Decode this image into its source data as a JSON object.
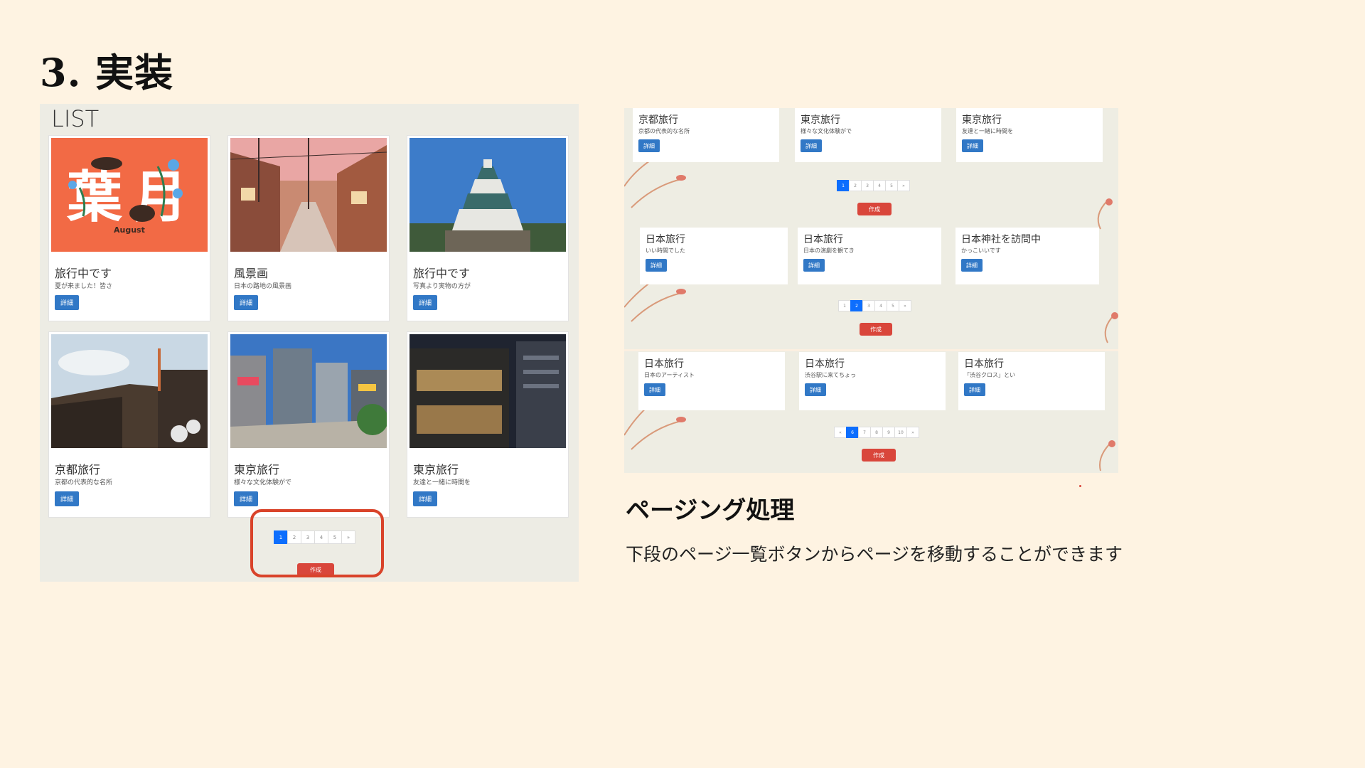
{
  "slide": {
    "title": "3. 実装",
    "section_heading": "ページング処理",
    "section_body": "下段のページ一覧ボタンからページを移動することができます"
  },
  "left_screenshot": {
    "heading": "LIST",
    "cards": [
      {
        "title": "旅行中です",
        "desc": "夏が来ました！皆さ",
        "button": "詳細",
        "image": "august-illustration"
      },
      {
        "title": "風景画",
        "desc": "日本の路地の風景画",
        "button": "詳細",
        "image": "street-illustration"
      },
      {
        "title": "旅行中です",
        "desc": "写真より実物の方が",
        "button": "詳細",
        "image": "castle-photo"
      },
      {
        "title": "京都旅行",
        "desc": "京都の代表的な名所",
        "button": "詳細",
        "image": "kyoto-photo"
      },
      {
        "title": "東京旅行",
        "desc": "様々な文化体験がで",
        "button": "詳細",
        "image": "shibuya-photo"
      },
      {
        "title": "東京旅行",
        "desc": "友達と一緒に時間を",
        "button": "詳細",
        "image": "night-building-photo"
      }
    ],
    "pager": [
      "1",
      "2",
      "3",
      "4",
      "5",
      "»"
    ],
    "pager_active": 0,
    "create_button": "作成",
    "august_text": "August",
    "august_kanji_left": "葉",
    "august_kanji_right": "月"
  },
  "right_screenshot": {
    "panels": [
      {
        "cards": [
          {
            "title": "京都旅行",
            "desc": "京都の代表的な名所",
            "button": "詳細"
          },
          {
            "title": "東京旅行",
            "desc": "様々な文化体験がで",
            "button": "詳細"
          },
          {
            "title": "東京旅行",
            "desc": "友達と一緒に時間を",
            "button": "詳細"
          }
        ],
        "pager": [
          "1",
          "2",
          "3",
          "4",
          "5",
          "»"
        ],
        "pager_active": 0,
        "create_button": "作成"
      },
      {
        "cards": [
          {
            "title": "日本旅行",
            "desc": "いい時間でした",
            "button": "詳細"
          },
          {
            "title": "日本旅行",
            "desc": "日本の演劇を観てき",
            "button": "詳細"
          },
          {
            "title": "日本神社を訪問中",
            "desc": "かっこいいです",
            "button": "詳細"
          }
        ],
        "pager": [
          "1",
          "2",
          "3",
          "4",
          "5",
          "»"
        ],
        "pager_active": 1,
        "create_button": "作成"
      },
      {
        "cards": [
          {
            "title": "日本旅行",
            "desc": "日本のアーティスト",
            "button": "詳細"
          },
          {
            "title": "日本旅行",
            "desc": "渋谷駅に来てちょっ",
            "button": "詳細"
          },
          {
            "title": "日本旅行",
            "desc": "「渋谷クロス」とい",
            "button": "詳細"
          }
        ],
        "pager": [
          "«",
          "6",
          "7",
          "8",
          "9",
          "10",
          "»"
        ],
        "pager_active": 1,
        "create_button": "作成"
      }
    ]
  },
  "colors": {
    "background": "#fef3e2",
    "primary_button": "#3178c6",
    "pager_active": "#0d6efd",
    "create_button": "#d9463b",
    "highlight_border": "#d9432a"
  }
}
